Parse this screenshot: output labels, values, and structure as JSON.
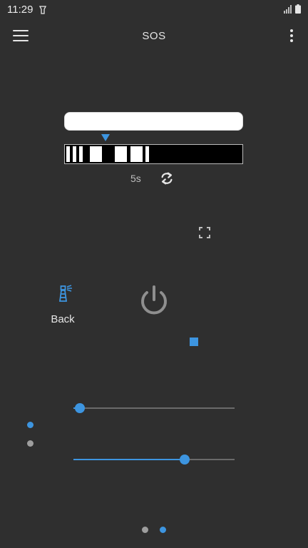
{
  "status_bar": {
    "time": "11:29"
  },
  "app_bar": {
    "title": "SOS"
  },
  "pattern": {
    "stripe_count": 7
  },
  "timer": {
    "duration": "5s"
  },
  "side_action": {
    "label": "Back"
  },
  "sliders": [
    {
      "name": "slider-top",
      "value": 0.04
    },
    {
      "name": "slider-bottom",
      "value": 0.69
    }
  ],
  "colors": {
    "accent": "#3d95e0",
    "background": "#2f2f2f",
    "inactive_dot": "#9e9e9e"
  },
  "pager": {
    "pages": 2,
    "active": 2
  }
}
